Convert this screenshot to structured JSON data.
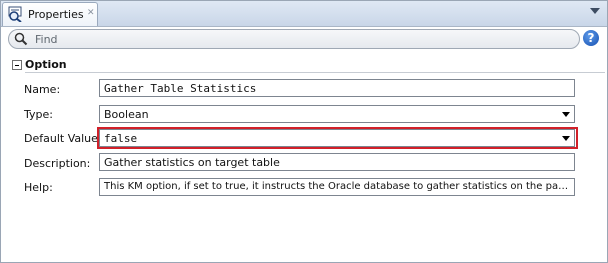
{
  "tab": {
    "label": "Properties",
    "close": "✕"
  },
  "search": {
    "placeholder": "Find"
  },
  "help": {
    "label": "?"
  },
  "section": {
    "title": "Option"
  },
  "rows": {
    "name": {
      "label": "Name:",
      "value": "Gather Table Statistics"
    },
    "type": {
      "label": "Type:",
      "value": "Boolean"
    },
    "default_value": {
      "label": "Default Value:",
      "value": "false"
    },
    "description": {
      "label": "Description:",
      "value": "Gather statistics on target table"
    },
    "help": {
      "label": "Help:",
      "value": "This KM option, if set to true, it instructs the Oracle database to gather statistics on the partition..."
    }
  },
  "colors": {
    "highlight": "#d12029",
    "help_icon": "#1650b0"
  }
}
